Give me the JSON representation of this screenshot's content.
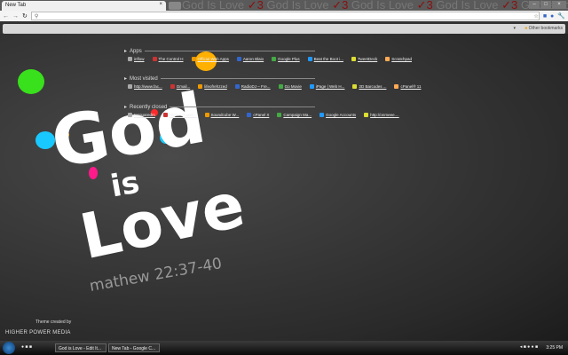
{
  "browser": {
    "tab_title": "New Tab",
    "theme_banner": "God Is Love",
    "omnibox_value": "",
    "other_bookmarks": "Other bookmarks"
  },
  "sections": [
    {
      "title": "Apps",
      "items": [
        "inflow",
        "The Control H",
        "Official Web Apps",
        "Aaron Blaio",
        "Google Plus",
        "Beat the Boot i...",
        "TweetDeck",
        "Scratchpad"
      ]
    },
    {
      "title": "Most visited",
      "items": [
        "http://www.fac...",
        "Gmail...",
        "lifeofrehzzed",
        "RadioDJ – Fre...",
        "Go Movie",
        "iPage | Web H...",
        "2D Barcodes ...",
        "cPanel® 11"
      ]
    },
    {
      "title": "Recently closed",
      "items": [
        "Insquaredm",
        "Higher Power...",
        "Soundcube W...",
        "cPanel X",
        "Campaign Ma...",
        "Google Accounts",
        "http://onmeee...."
      ]
    }
  ],
  "artwork": {
    "line1": "God",
    "line2": "is",
    "line3": "Love",
    "verse": "mathew 22:37-40"
  },
  "theme_credit": {
    "label": "Theme created by",
    "brand": "HIGHER POWER MEDIA"
  },
  "taskbar": {
    "tasks": [
      "God is Love - Edit It...",
      "New Tab - Google C..."
    ],
    "clock": "3:25 PM"
  },
  "colors": {
    "splatters": [
      "#39e01c",
      "#ffb000",
      "#18c8ff",
      "#ff1a8c",
      "#ff2a2a",
      "#ffffff"
    ]
  }
}
